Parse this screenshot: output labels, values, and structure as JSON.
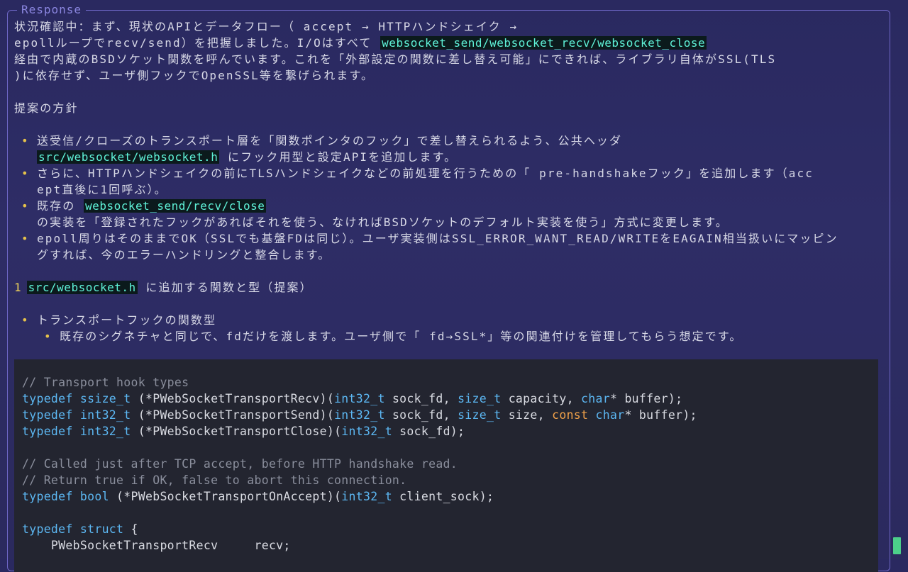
{
  "panel": {
    "title": "Response"
  },
  "intro": {
    "line1": "状況確認中：まず、現状のAPIとデータフロー（ accept → HTTPハンドシェイク →",
    "line2_pre": "epollループでrecv/send）を把握しました。I/Oはすべて ",
    "line2_code": "websocket_send/websocket_recv/websocket_close",
    "line3": "経由で内蔵のBSDソケット関数を呼んでいます。これを「外部設定の関数に差し替え可能」にできれば、ライブラリ自体がSSL(TLS",
    "line4": ")に依存せず、ユーザ側フックでOpenSSL等を繋げられます。"
  },
  "heading": "提案の方針",
  "bullets": {
    "b1_line1": "送受信/クローズのトランスポート層を「関数ポインタのフック」で差し替えられるよう、公共ヘッダ",
    "b1_code": "src/websocket/websocket.h",
    "b1_tail": " にフック用型と設定APIを追加します。",
    "b2_line1": "さらに、HTTPハンドシェイクの前にTLSハンドシェイクなどの前処理を行うための「 pre-handshakeフック」を追加します（acc",
    "b2_line2": "ept直後に1回呼ぶ）。",
    "b3_pre": "既存の ",
    "b3_code": "websocket_send/recv/close",
    "b3_line2": "の実装を「登録されたフックがあればそれを使う、なければBSDソケットのデフォルト実装を使う」方式に変更します。",
    "b4_line1": "epoll周りはそのままでOK（SSLでも基盤FDは同じ）。ユーザ実装側はSSL_ERROR_WANT_READ/WRITEをEAGAIN相当扱いにマッピン",
    "b4_line2": "グすれば、今のエラーハンドリングと整合します。"
  },
  "section1": {
    "number": "1",
    "code": "src/websocket.h",
    "text": " に追加する関数と型（提案）"
  },
  "types": {
    "bullet": "トランスポートフックの関数型",
    "sub": "既存のシグネチャと同じで、fdだけを渡します。ユーザ側で「 fd→SSL*」等の関連付けを管理してもらう想定です。"
  },
  "code_block": {
    "c1": "// Transport hook types",
    "t1_kw": "typedef",
    "t1_ty": "ssize_t",
    "t1_name": " (*PWebSocketTransportRecv)(",
    "t1_p1": "int32_t",
    "t1_p2": " sock_fd, ",
    "t1_p3": "size_t",
    "t1_p4": " capacity, ",
    "t1_p5": "char",
    "t1_p6": "* buffer);",
    "t2_kw": "typedef",
    "t2_ty": "int32_t",
    "t2_name": " (*PWebSocketTransportSend)(",
    "t2_p1": "int32_t",
    "t2_p2": " sock_fd, ",
    "t2_p3": "size_t",
    "t2_p4": " size, ",
    "t2_p5": "const",
    "t2_p6": "char",
    "t2_p7": "* buffer);",
    "t3_kw": "typedef",
    "t3_ty": "int32_t",
    "t3_name": " (*PWebSocketTransportClose)(",
    "t3_p1": "int32_t",
    "t3_p2": " sock_fd);",
    "c2": "// Called just after TCP accept, before HTTP handshake read.",
    "c3": "// Return true if OK, false to abort this connection.",
    "t4_kw": "typedef",
    "t4_ty": "bool",
    "t4_name": " (*PWebSocketTransportOnAccept)(",
    "t4_p1": "int32_t",
    "t4_p2": " client_sock);",
    "s_kw1": "typedef",
    "s_kw2": "struct",
    "s_brace": " {",
    "s_field": "    PWebSocketTransportRecv     recv;"
  },
  "colors": {
    "background": "#2a2960",
    "border": "#6f67c7",
    "highlight_text": "#5ff2d8",
    "bullet": "#e6c24a",
    "code_bg": "#232530",
    "keyword": "#5cb7f2",
    "const_keyword": "#f2a24a",
    "scroll_thumb": "#4ccf8a"
  }
}
